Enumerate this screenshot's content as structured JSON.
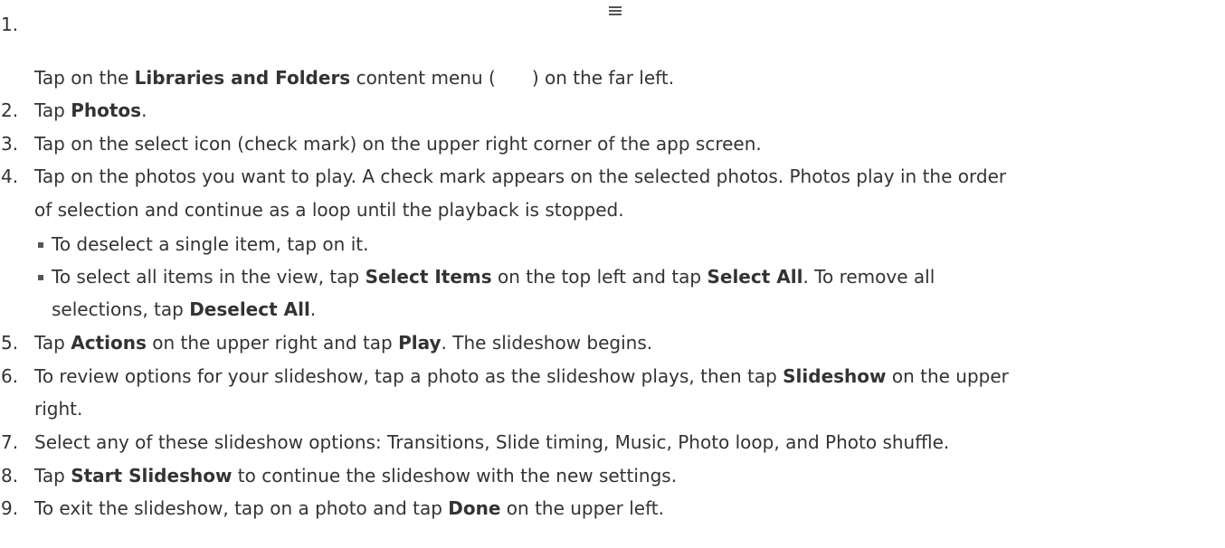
{
  "steps": [
    {
      "num": "1.",
      "a": "Tap on the ",
      "b1": "Libraries and Folders",
      "c": " content menu (",
      "d": ") on the far left."
    },
    {
      "num": "2.",
      "a": "Tap ",
      "b1": "Photos",
      "c": "."
    },
    {
      "num": "3.",
      "a": "Tap on the select icon (check mark) on the upper right corner of the app screen."
    },
    {
      "num": "4.",
      "l1": "Tap on the photos you want to play. A check mark appears on the selected photos. Photos play in the order",
      "l2": "of selection and continue as a loop until the playback is stopped."
    },
    {
      "num": "5.",
      "a": "Tap ",
      "b1": "Actions",
      "c": " on the upper right and tap ",
      "b2": "Play",
      "d": ". The slideshow begins."
    },
    {
      "num": "6.",
      "a": "To review options for your slideshow, tap a photo as the slideshow plays, then tap ",
      "b1": "Slideshow",
      "c": " on the upper",
      "l2": "right."
    },
    {
      "num": "7.",
      "a": "Select any of these slideshow options: Transitions, Slide timing, Music, Photo loop, and Photo shuffle."
    },
    {
      "num": "8.",
      "a": "Tap ",
      "b1": "Start Slideshow",
      "c": " to continue the slideshow with the new settings."
    },
    {
      "num": "9.",
      "a": "To exit the slideshow, tap on a photo and tap ",
      "b1": "Done",
      "c": " on the upper left."
    }
  ],
  "sub": [
    {
      "a": "To deselect a single item, tap on it."
    },
    {
      "a": "To select all items in the view, tap ",
      "b1": "Select Items",
      "c": " on the top left and tap ",
      "b2": "Select All",
      "d": ". To remove all",
      "l2a": "selections, tap ",
      "l2b": "Deselect All",
      "l2c": "."
    }
  ],
  "icons": {
    "menu": "hamburger-menu-icon"
  }
}
